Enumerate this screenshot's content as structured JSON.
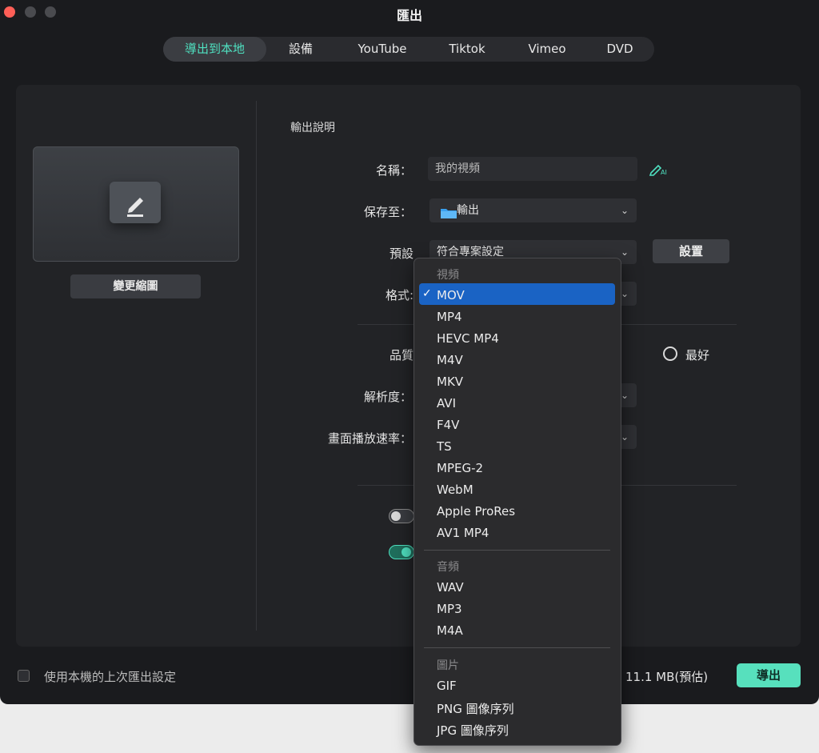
{
  "window": {
    "title": "匯出"
  },
  "tabs": [
    "導出到本地",
    "設備",
    "YouTube",
    "Tiktok",
    "Vimeo",
    "DVD"
  ],
  "left": {
    "change_thumbnail": "變更縮圖"
  },
  "form": {
    "section_title": "輸出說明",
    "name_label": "名稱：",
    "name_value": "我的視頻",
    "save_label": "保存至：",
    "save_value": "輸出",
    "preset_label": "預設",
    "preset_value": "符合專案設定",
    "settings_button": "設置",
    "format_label": "格式:",
    "quality_label": "品質",
    "quality_best": "最好",
    "resolution_label": "解析度：",
    "framerate_label": "畫面播放速率："
  },
  "footer": {
    "use_last_settings": "使用本機的上次匯出設定",
    "size_estimate": "11.1 MB(預估)",
    "export_button": "導出"
  },
  "menu": {
    "video_header": "視頻",
    "video_items": [
      "MOV",
      "MP4",
      "HEVC MP4",
      "M4V",
      "MKV",
      "AVI",
      "F4V",
      "TS",
      "MPEG-2",
      "WebM",
      "Apple ProRes",
      "AV1 MP4"
    ],
    "audio_header": "音頻",
    "audio_items": [
      "WAV",
      "MP3",
      "M4A"
    ],
    "image_header": "圖片",
    "image_items": [
      "GIF",
      "PNG 圖像序列",
      "JPG 圖像序列"
    ],
    "selected": "MOV"
  },
  "colors": {
    "accent": "#4fe0c0",
    "export_button": "#57e0bd",
    "selection": "#1a63c4"
  }
}
